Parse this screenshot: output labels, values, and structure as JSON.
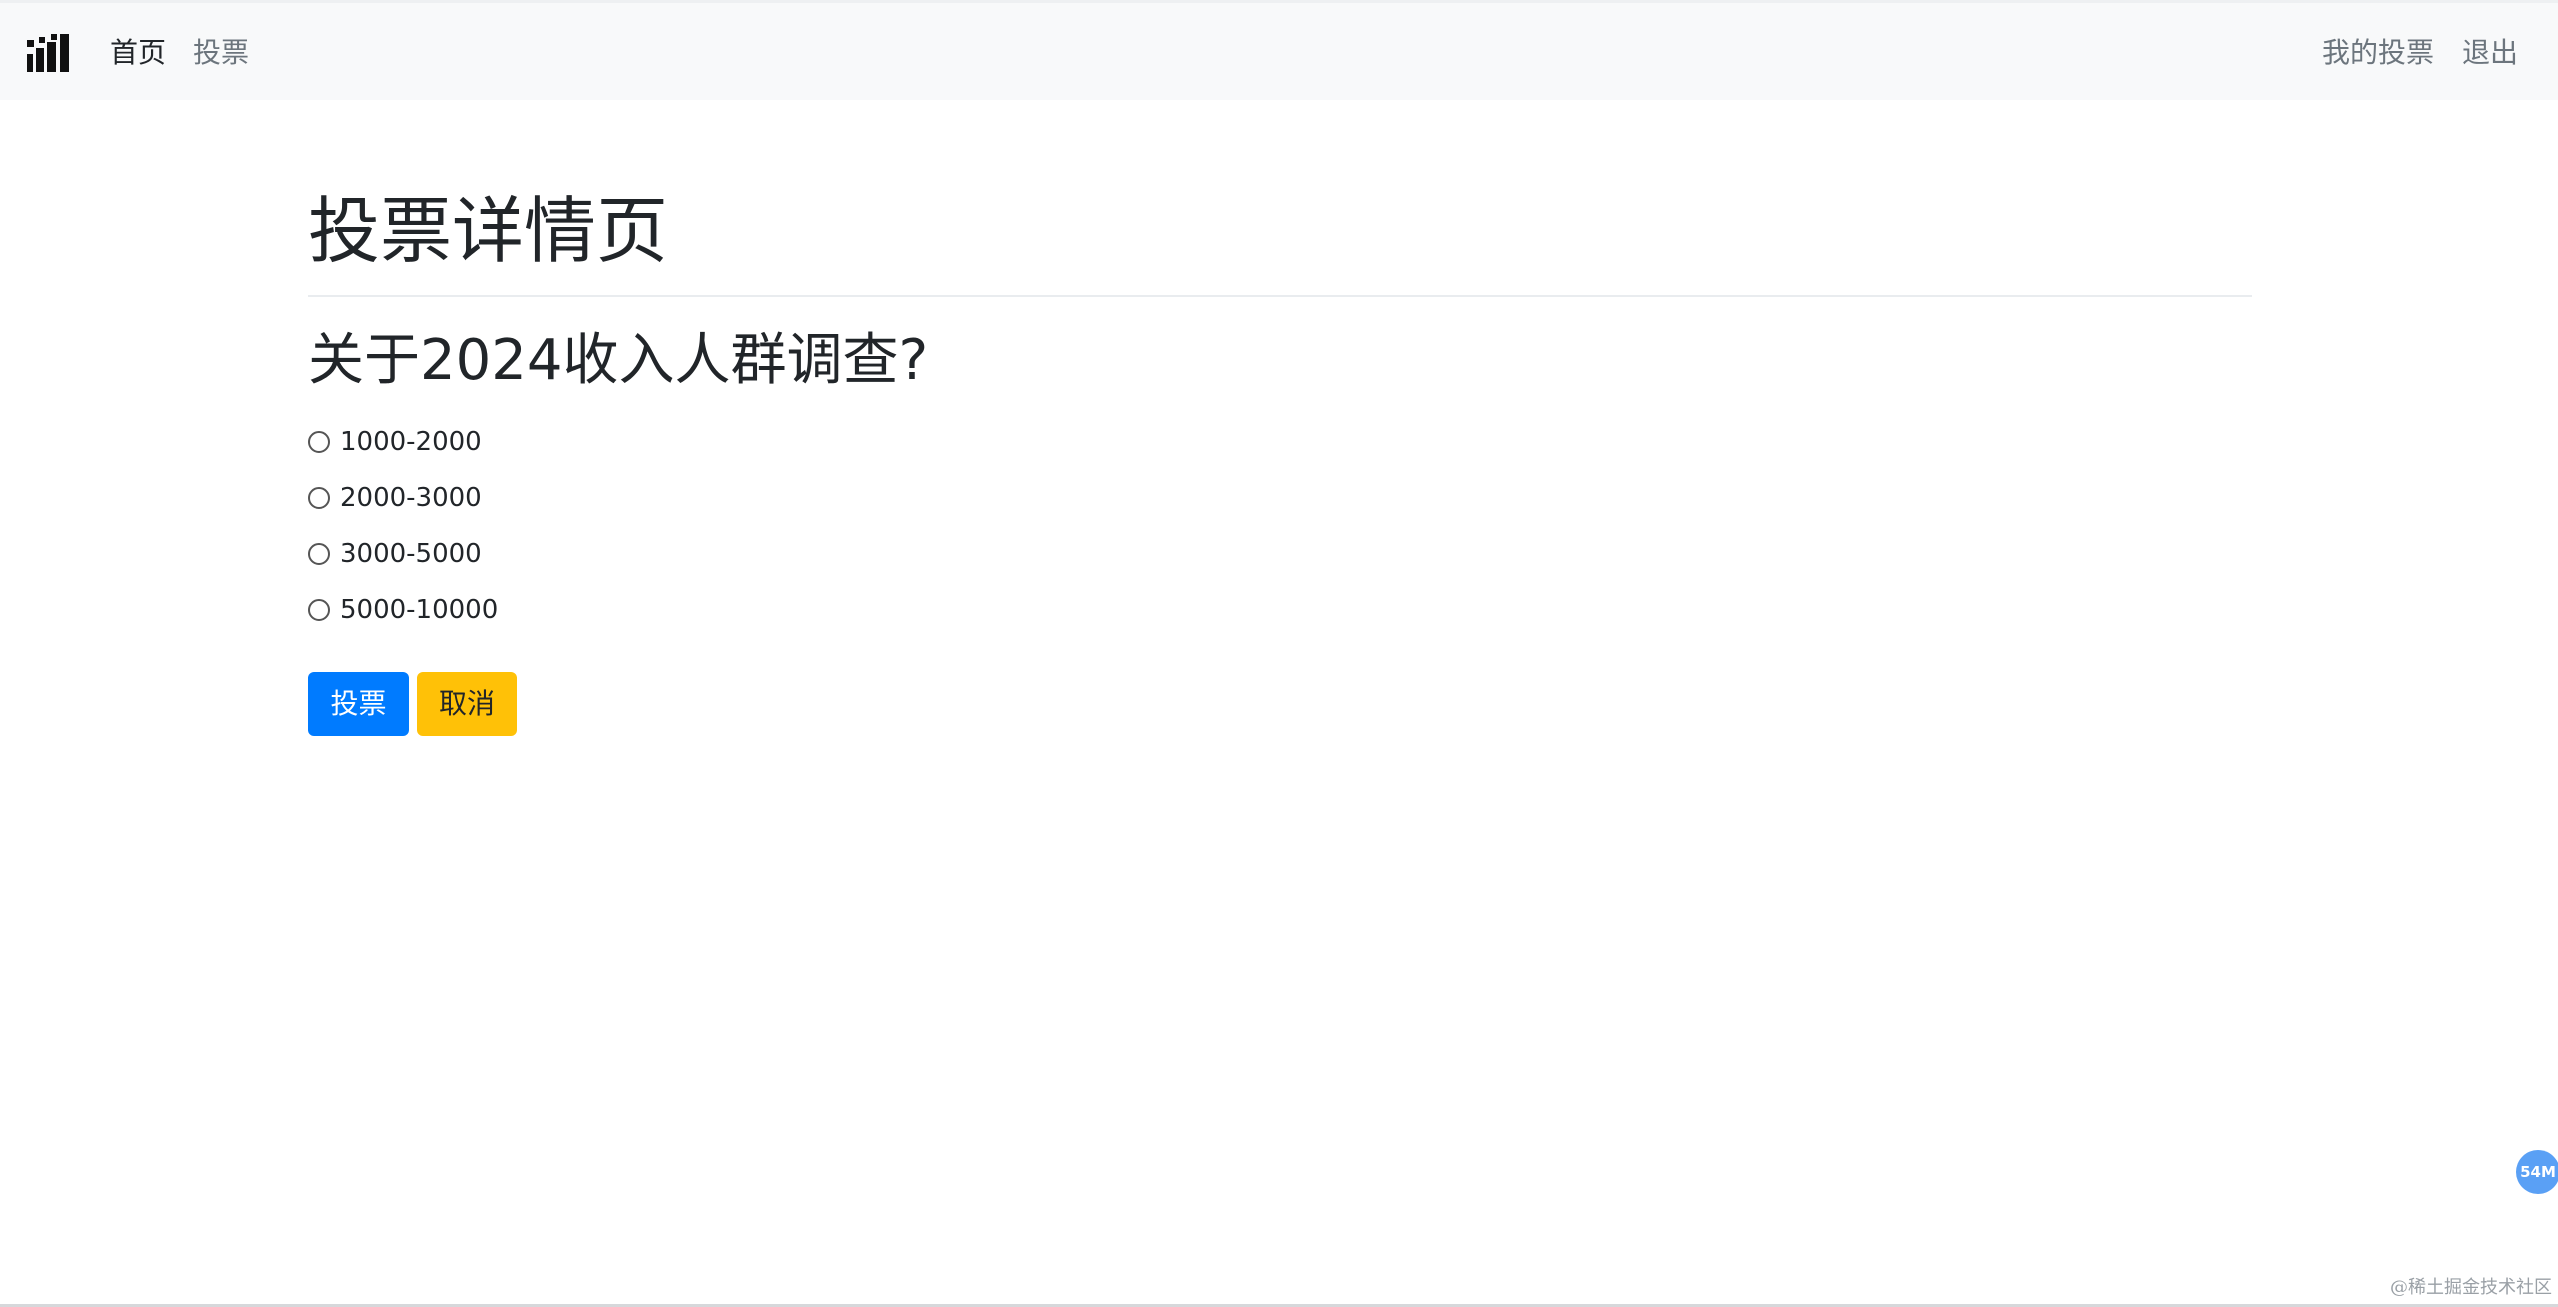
{
  "navbar": {
    "links": {
      "home": "首页",
      "vote": "投票",
      "my_votes": "我的投票",
      "logout": "退出"
    }
  },
  "main": {
    "page_title": "投票详情页",
    "question": "关于2024收入人群调查?",
    "options": [
      {
        "label": "1000-2000",
        "selected": false
      },
      {
        "label": "2000-3000",
        "selected": false
      },
      {
        "label": "3000-5000",
        "selected": false
      },
      {
        "label": "5000-10000",
        "selected": false
      }
    ],
    "buttons": {
      "vote": "投票",
      "cancel": "取消"
    }
  },
  "overlay": {
    "memory_badge": "54M",
    "watermark": "@稀土掘金技术社区"
  },
  "colors": {
    "navbar_bg": "#f8f9fa",
    "primary": "#007bff",
    "warning": "#ffc107",
    "muted": "#6c757d",
    "text": "#212529"
  }
}
